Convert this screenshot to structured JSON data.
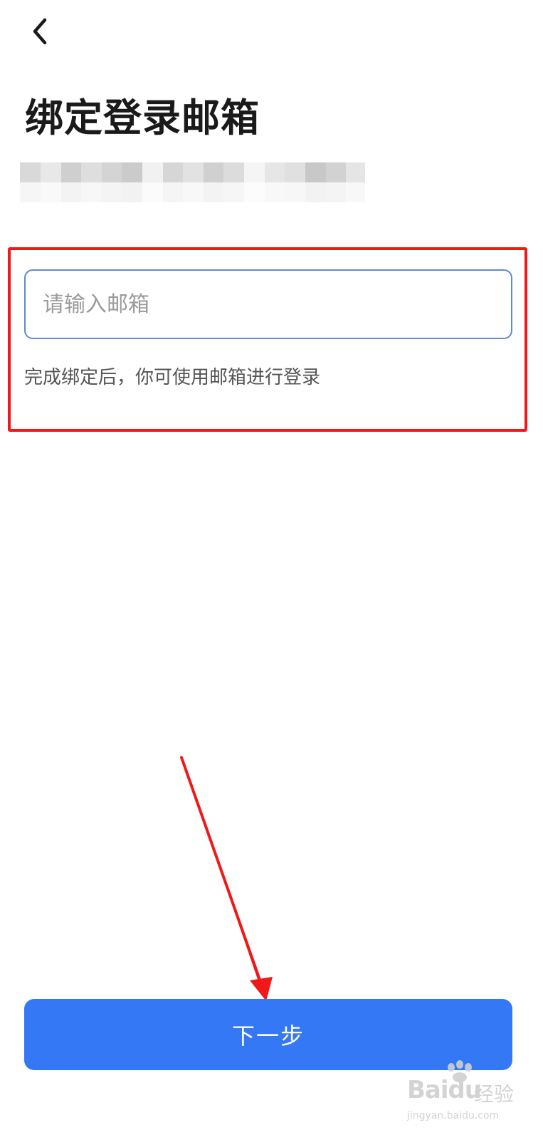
{
  "header": {
    "back_icon": "chevron-left-icon",
    "title": "绑定登录邮箱"
  },
  "account": {
    "masked": true
  },
  "form": {
    "email_placeholder": "请输入邮箱",
    "email_value": "",
    "hint": "完成绑定后，你可使用邮箱进行登录"
  },
  "footer": {
    "next_label": "下一步"
  },
  "watermark": {
    "logo": "Baidu",
    "cn": "经验",
    "url": "jingyan.baidu.com"
  },
  "colors": {
    "primary": "#3478f6",
    "annotation": "#f01818",
    "input_border": "#5f89d6"
  }
}
